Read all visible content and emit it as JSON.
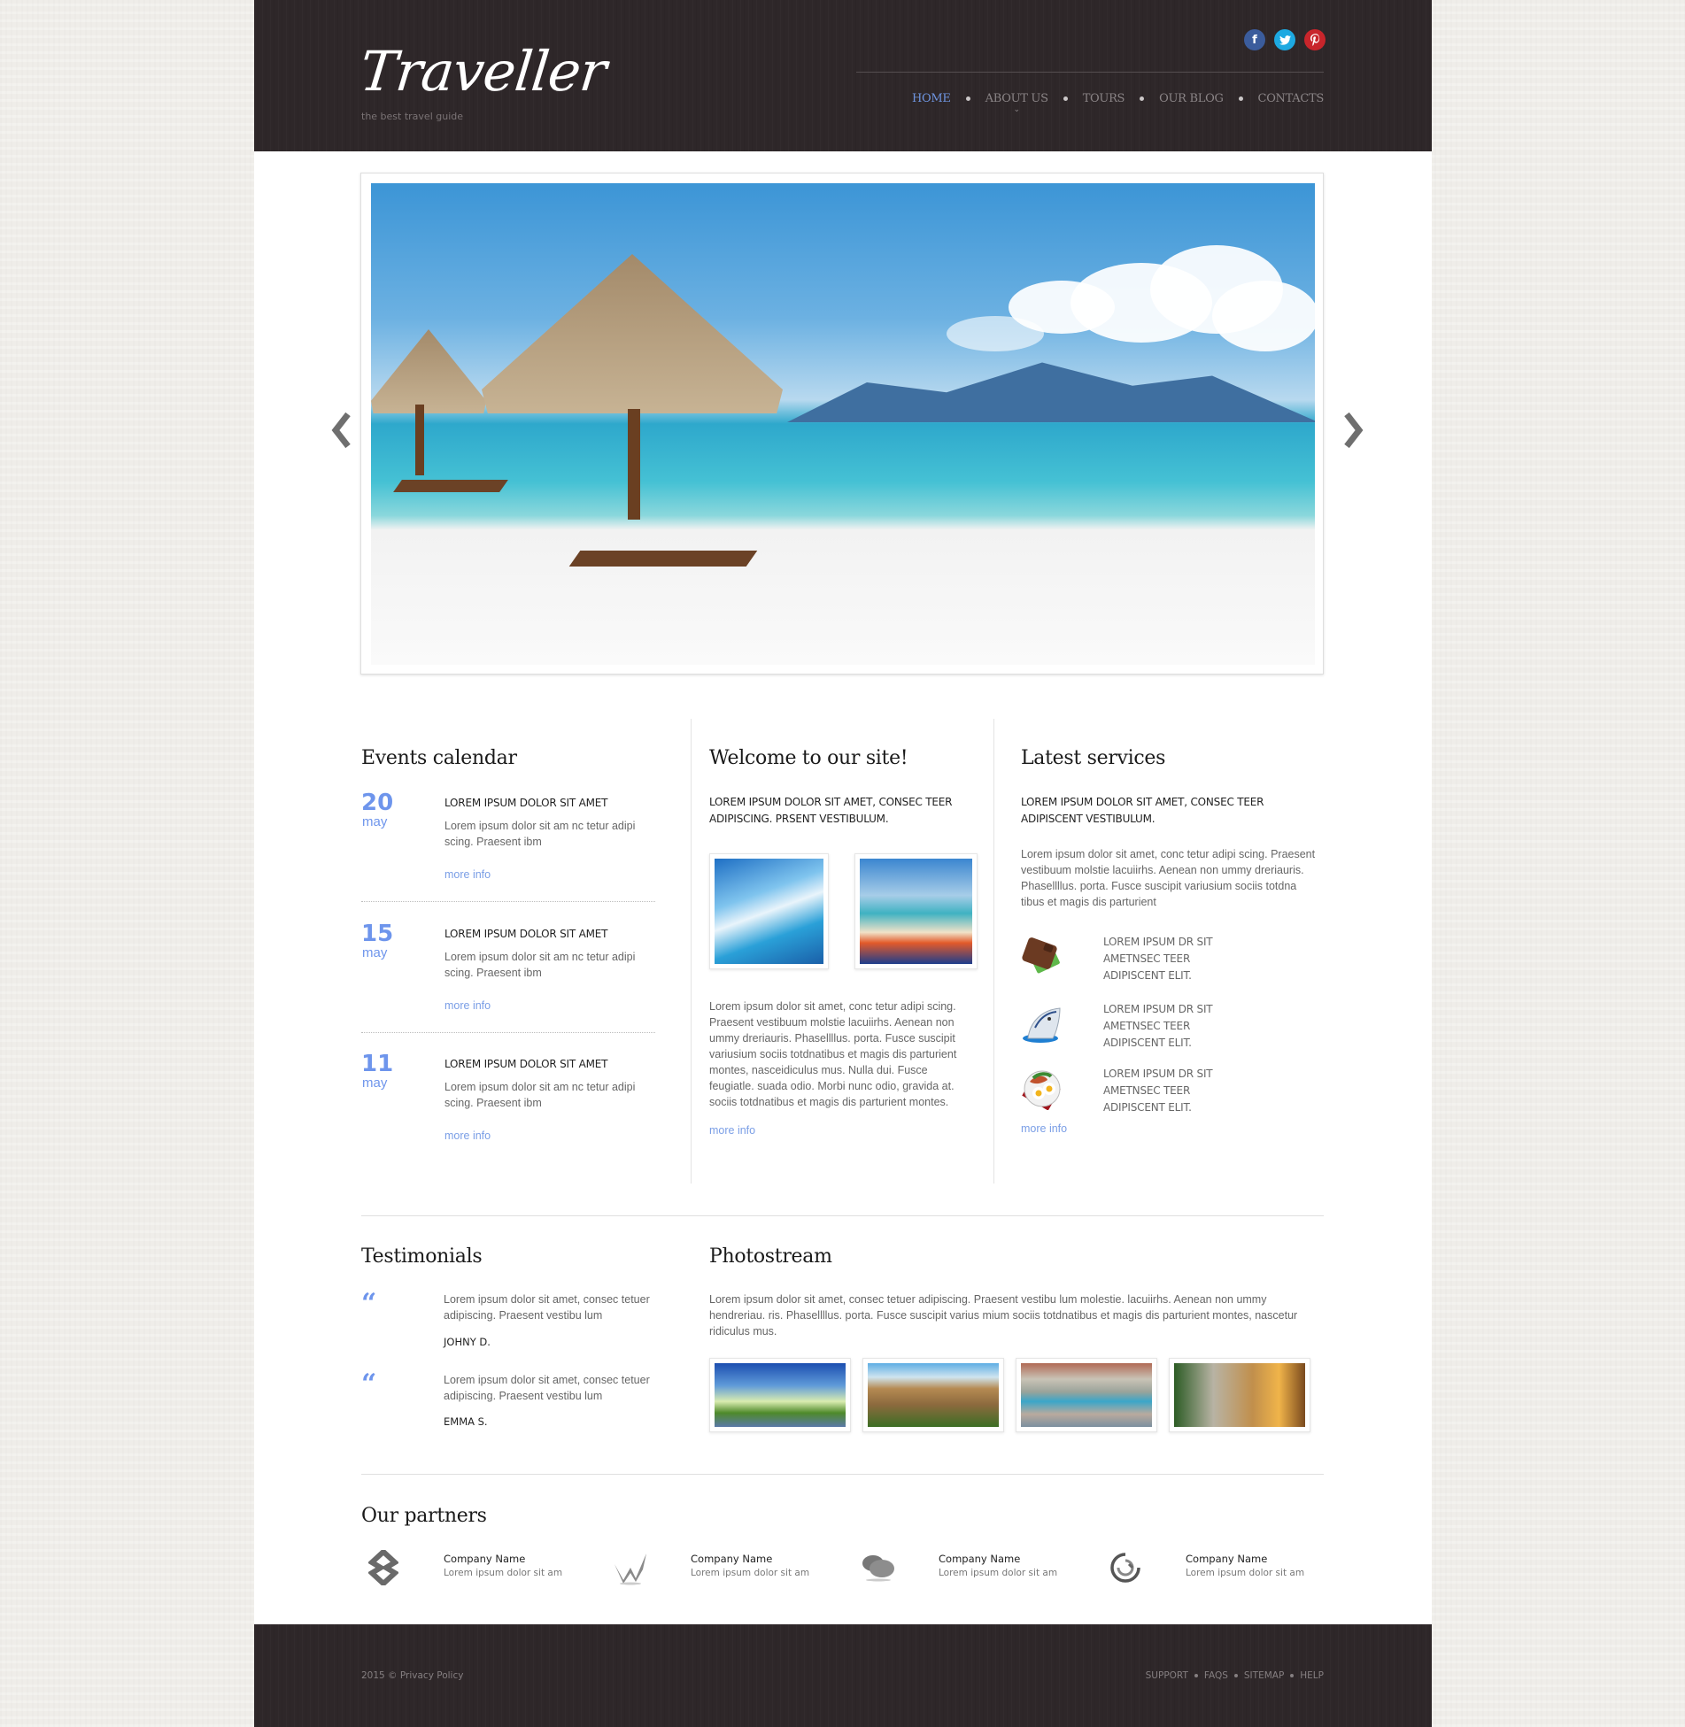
{
  "header": {
    "logo": "Traveller",
    "tagline": "the best travel guide",
    "social": [
      {
        "icon": "facebook-icon",
        "glyph": "f",
        "color": "#3b5c9c"
      },
      {
        "icon": "twitter-icon",
        "glyph": "t",
        "color": "#1da9e1"
      },
      {
        "icon": "pinterest-icon",
        "glyph": "p",
        "color": "#c8252b"
      }
    ],
    "nav": [
      {
        "label": "HOME",
        "active": true
      },
      {
        "label": "ABOUT US",
        "has_submenu": true
      },
      {
        "label": "TOURS"
      },
      {
        "label": "OUR BLOG"
      },
      {
        "label": "CONTACTS"
      }
    ],
    "submenu_caret": "⌄"
  },
  "slider": {
    "prev_icon": "chevron-left-icon",
    "next_icon": "chevron-right-icon"
  },
  "events": {
    "title": "Events calendar",
    "items": [
      {
        "day": "20",
        "month": "may",
        "title": "LOREM IPSUM DOLOR SIT AMET",
        "text": "Lorem ipsum dolor sit am nc tetur adipi scing. Praesent ibm",
        "link": "more info"
      },
      {
        "day": "15",
        "month": "may",
        "title": "LOREM IPSUM DOLOR SIT AMET",
        "text": "Lorem ipsum dolor sit am nc tetur adipi scing. Praesent ibm",
        "link": "more info"
      },
      {
        "day": "11",
        "month": "may",
        "title": "LOREM IPSUM DOLOR SIT AMET",
        "text": "Lorem ipsum dolor sit am nc tetur adipi scing. Praesent ibm",
        "link": "more info"
      }
    ]
  },
  "welcome": {
    "title": "Welcome to our site!",
    "subtitle": "LOREM IPSUM DOLOR SIT AMET, CONSEC TEER ADIPISCING. PRSENT VESTIBULUM.",
    "text": "Lorem ipsum dolor sit amet, conc tetur adipi scing. Praesent vestibuum molstie lacuiirhs. Aenean non ummy dreriauris. Phasellllus. porta. Fusce suscipit variusium sociis totdnatibus et magis dis parturient montes, nasceidiculus mus. Nulla dui. Fusce feugiatle. suada odio. Morbi nunc odio, gravida at. sociis totdnatibus et magis dis parturient montes.",
    "link": "more info"
  },
  "services": {
    "title": "Latest services",
    "subtitle": "LOREM IPSUM DOLOR SIT AMET, CONSEC TEER ADIPISCENT VESTIBULUM.",
    "text": "Lorem ipsum dolor sit amet, conc tetur adipi scing. Praesent vestibuum molstie lacuiirhs. Aenean non ummy dreriauris. Phasellllus. porta. Fusce suscipit variusium sociis totdna tibus et magis dis parturient",
    "items": [
      {
        "icon": "wallet-icon",
        "text": "LOREM IPSUM DR SIT AMETNSEC TEER ADIPISCENT ELIT."
      },
      {
        "icon": "ship-icon",
        "text": "LOREM IPSUM DR SIT AMETNSEC TEER ADIPISCENT ELIT."
      },
      {
        "icon": "breakfast-plate-icon",
        "text": "LOREM IPSUM DR SIT AMETNSEC TEER ADIPISCENT ELIT."
      }
    ],
    "link": "more info"
  },
  "testimonials": {
    "title": "Testimonials",
    "quote_glyph": "“",
    "items": [
      {
        "text": "Lorem ipsum dolor sit amet, consec tetuer adipiscing. Praesent vestibu lum",
        "author": "JOHNY D."
      },
      {
        "text": "Lorem ipsum dolor sit amet, consec tetuer adipiscing. Praesent vestibu lum",
        "author": "EMMA S."
      }
    ]
  },
  "photostream": {
    "title": "Photostream",
    "text": "Lorem ipsum dolor sit amet, consec tetuer adipiscing. Praesent vestibu lum molestie. lacuiirhs. Aenean non ummy hendreriau. ris. Phasellllus. porta. Fusce suscipit varius mium sociis totdnatibus et magis dis parturient montes, nascetur ridiculus mus.",
    "photos": [
      "eiffel-tower-photo",
      "colosseum-photo",
      "coastal-hotel-photo",
      "roman-forum-photo"
    ]
  },
  "partners": {
    "title": "Our partners",
    "items": [
      {
        "icon": "partner-s-logo-icon",
        "name": "Company Name",
        "desc": "Lorem ipsum dolor sit am"
      },
      {
        "icon": "partner-w-logo-icon",
        "name": "Company Name",
        "desc": "Lorem ipsum dolor sit am"
      },
      {
        "icon": "partner-chat-logo-icon",
        "name": "Company Name",
        "desc": "Lorem ipsum dolor sit am"
      },
      {
        "icon": "partner-swirl-logo-icon",
        "name": "Company Name",
        "desc": "Lorem ipsum dolor sit am"
      }
    ]
  },
  "footer": {
    "copyright": "2015 © Privacy Policy",
    "links": [
      "SUPPORT",
      "FAQS",
      "SITEMAP",
      "HELP"
    ]
  },
  "colors": {
    "accent": "#6e95ec",
    "header_bg": "#2e2729",
    "page_bg": "#efede9"
  }
}
